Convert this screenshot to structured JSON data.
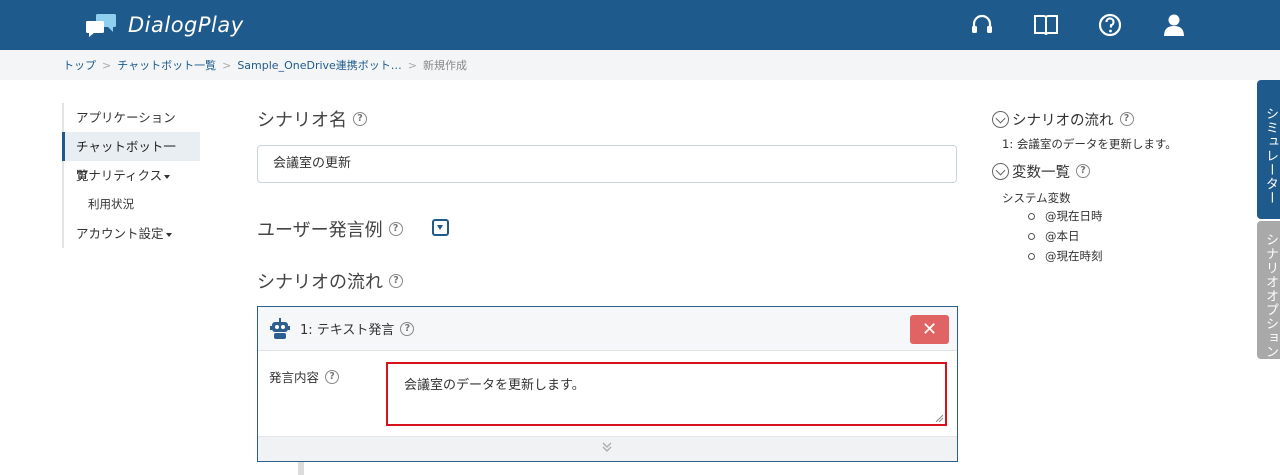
{
  "app": {
    "name": "DialogPlay"
  },
  "header_icons": [
    "headset-icon",
    "book-icon",
    "help-icon",
    "user-icon"
  ],
  "breadcrumb": {
    "items": [
      "トップ",
      "チャットボット一覧",
      "Sample_OneDrive連携ボット…"
    ],
    "current": "新規作成"
  },
  "sidebar": {
    "items": [
      {
        "label": "アプリケーション"
      },
      {
        "label": "チャットボット一覧",
        "active": true
      },
      {
        "label": "アナリティクス"
      },
      {
        "label": "利用状況"
      },
      {
        "label": "アカウント設定"
      }
    ]
  },
  "scenario_name": {
    "title": "シナリオ名",
    "value": "会議室の更新"
  },
  "user_examples": {
    "title": "ユーザー発言例"
  },
  "scenario_flow": {
    "title": "シナリオの流れ"
  },
  "step": {
    "title": "1: テキスト発言",
    "field_label": "発言内容",
    "content": "会議室のデータを更新します。",
    "delete_label": "✕"
  },
  "right_panel": {
    "flow_title": "シナリオの流れ",
    "flow_item": "1: 会議室のデータを更新します。",
    "vars_title": "変数一覧",
    "system_vars_label": "システム変数",
    "system_vars": [
      "@現在日時",
      "@本日",
      "@現在時刻"
    ]
  },
  "tabs": {
    "simulator": "シミュレーター",
    "scenario_options": "シナリオオプション"
  },
  "colors": {
    "header": "#1f5a8c",
    "delete": "#e06464",
    "highlight": "#d8121c",
    "tab_inactive": "#a9a9a9"
  }
}
